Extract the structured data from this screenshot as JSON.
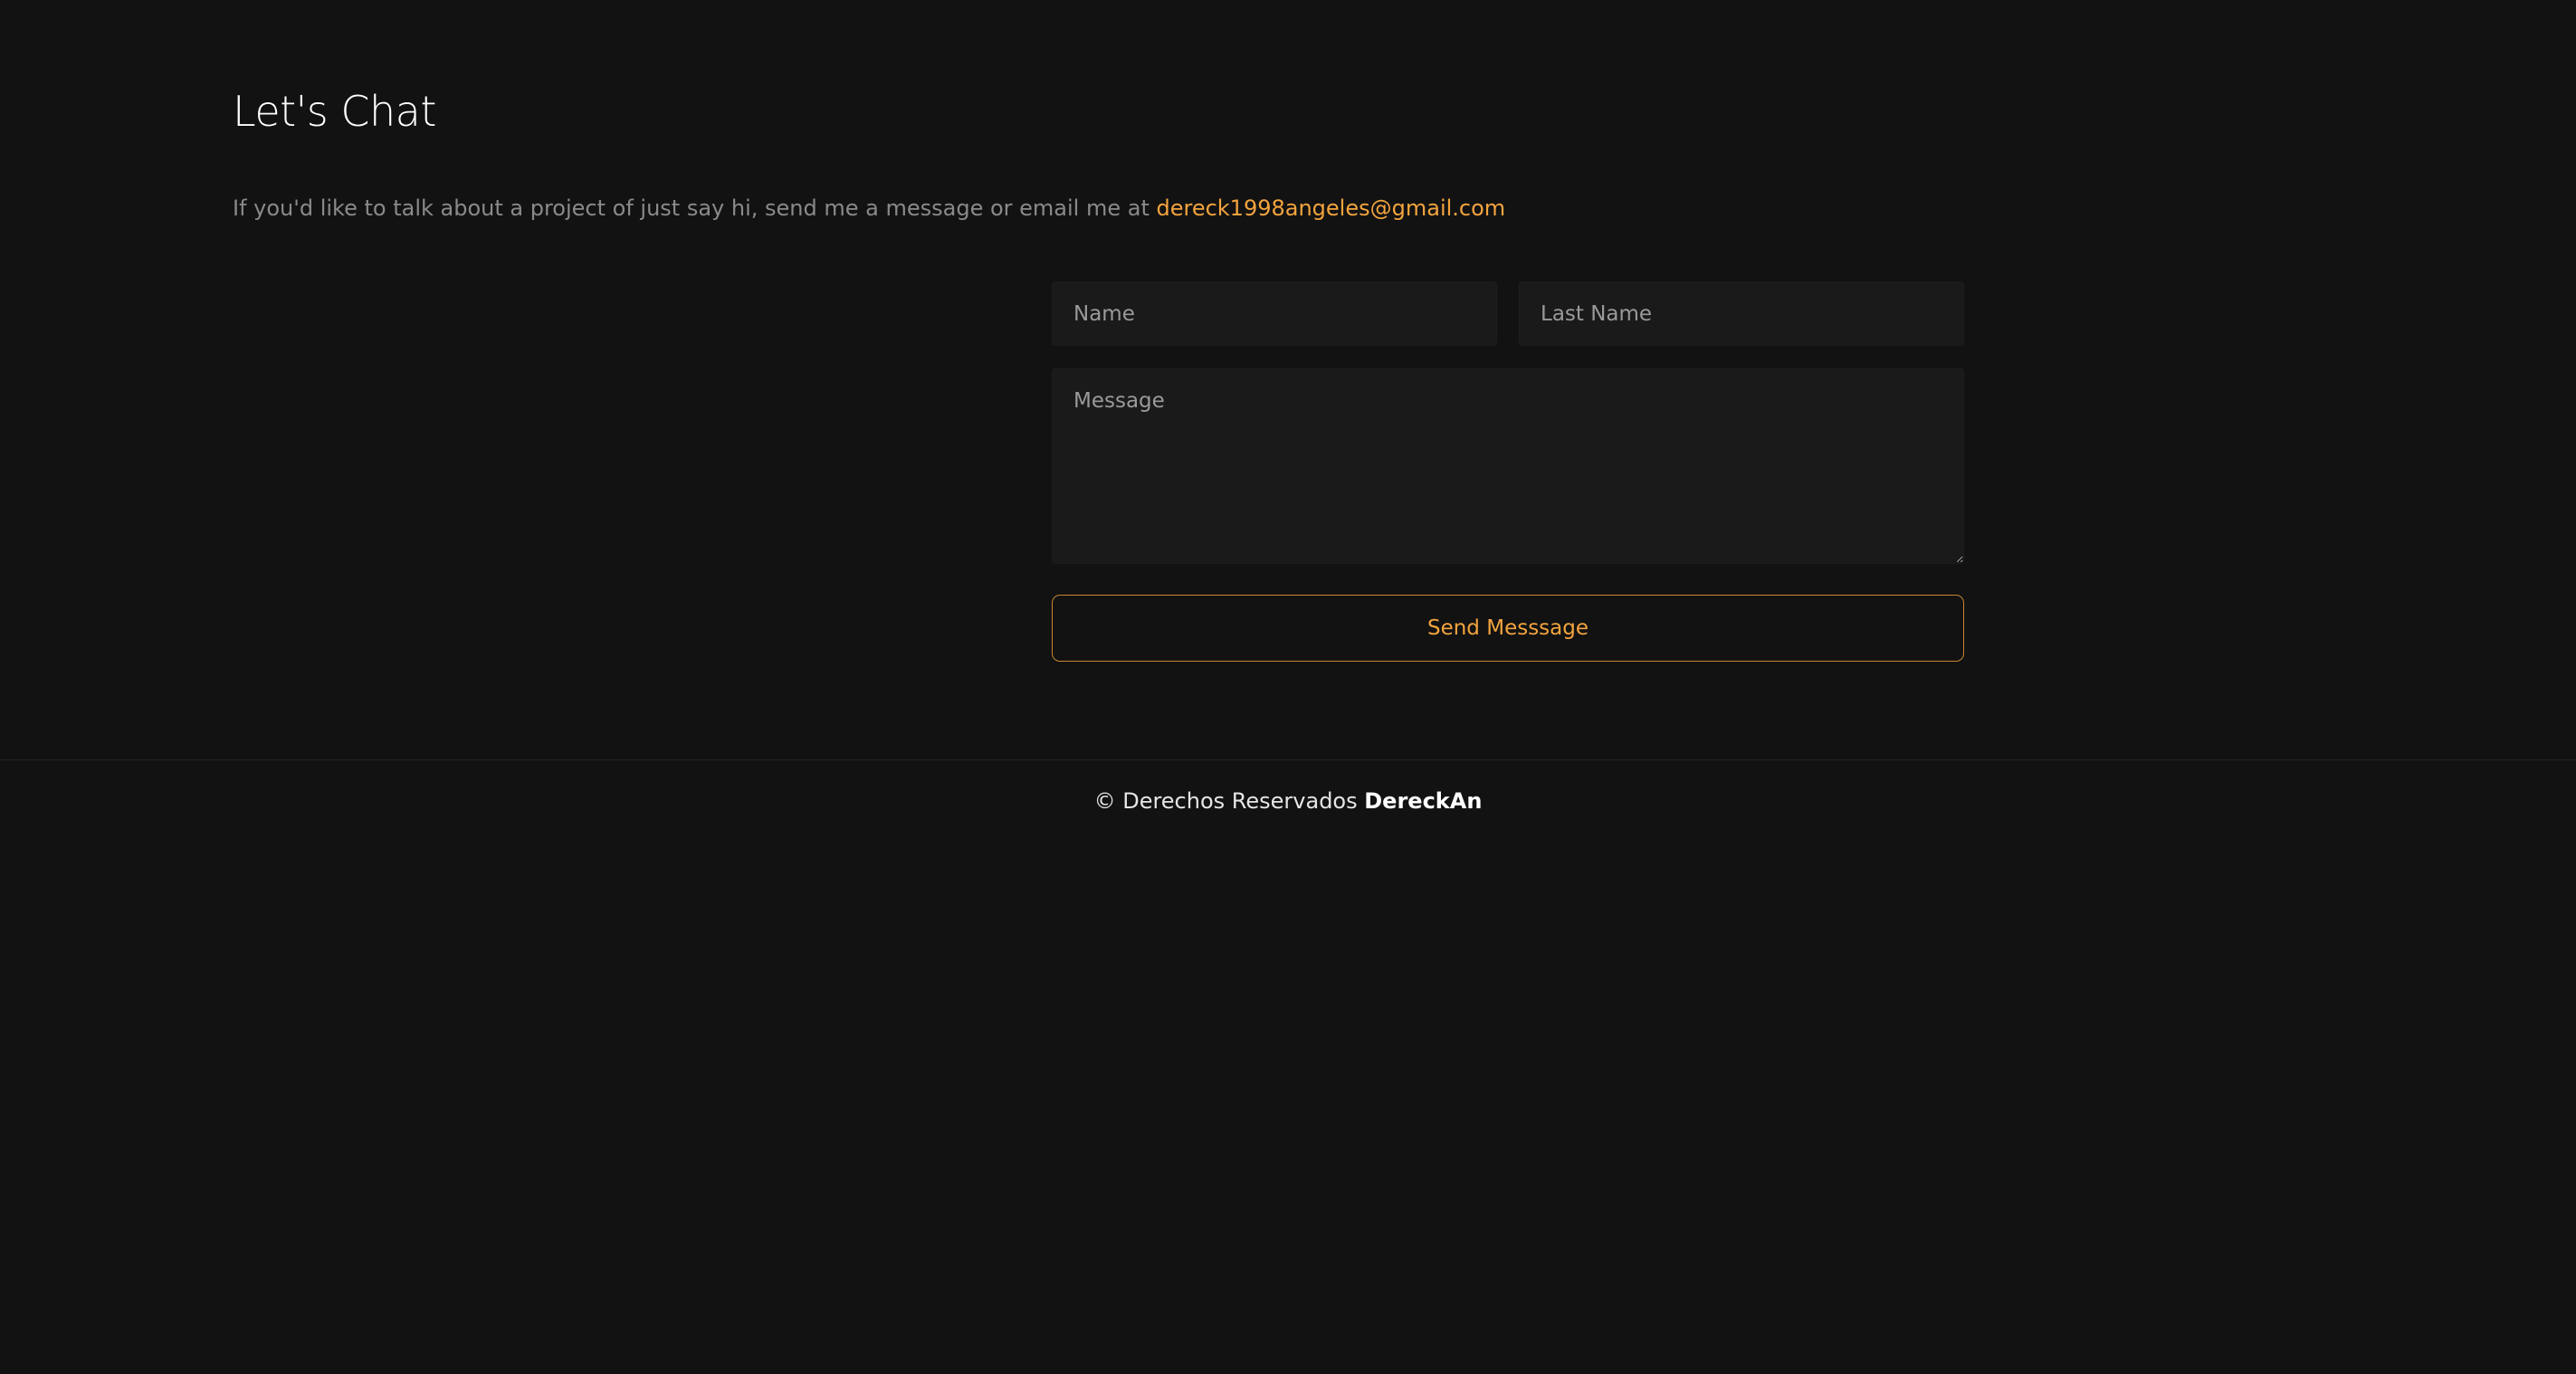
{
  "contact": {
    "title": "Let's Chat",
    "intro_text": "If you'd like to talk about a project of just say hi, send me a message or email me at ",
    "email": "dereck1998angeles@gmail.com"
  },
  "form": {
    "name_placeholder": "Name",
    "last_name_placeholder": "Last Name",
    "message_placeholder": "Message",
    "send_label": "Send Messsage"
  },
  "footer": {
    "prefix": "© Derechos Reservados ",
    "brand": "DereckAn"
  },
  "colors": {
    "background": "#121212",
    "accent": "#f3a43e",
    "field_background": "#1a1a1a",
    "muted_text": "#8a8a8a"
  }
}
